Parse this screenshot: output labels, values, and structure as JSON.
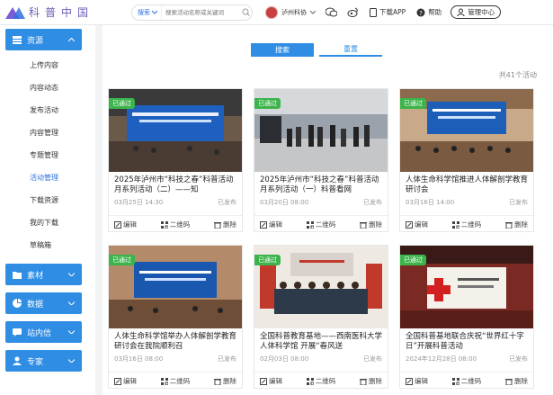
{
  "header": {
    "logo_text": "科普中国",
    "search": {
      "scope": "搜索",
      "placeholder": "搜索活动名称或关键词"
    },
    "org_name": "泸州科协",
    "app_label": "下载APP",
    "help_label": "帮助",
    "admin_label": "管理中心"
  },
  "sidebar": {
    "resources_label": "资源",
    "items": [
      "上传内容",
      "内容动态",
      "发布活动",
      "内容管理",
      "专题管理",
      "活动管理",
      "下载资源",
      "我的下载",
      "草稿箱"
    ],
    "active_index": 5,
    "groups": [
      "素材",
      "数据",
      "站内信",
      "专家"
    ]
  },
  "main": {
    "tab_primary": "搜索",
    "tab_secondary": "重置",
    "total": "共41个活动",
    "cards": [
      {
        "status": "已通过",
        "title": "2025年泸州市“科技之春”科普活动月系列活动（二）——知",
        "date": "03月25日 14:30",
        "state": "已发布",
        "edit": "编辑",
        "qr": "二维码",
        "del": "删除"
      },
      {
        "status": "已通过",
        "title": "2025年泸州市“科技之春”科普活动月系列活动（一）科普看网",
        "date": "03月20日 08:00",
        "state": "已发布",
        "edit": "编辑",
        "qr": "二维码",
        "del": "删除"
      },
      {
        "status": "已通过",
        "title": "人体生命科学馆推进人体解剖学教育研讨会",
        "date": "03月16日 14:00",
        "state": "已发布",
        "edit": "编辑",
        "qr": "二维码",
        "del": "删除"
      },
      {
        "status": "已通过",
        "title": "人体生命科学馆举办人体解剖学教育研讨会在我院顺利召",
        "date": "03月16日 08:00",
        "state": "已发布",
        "edit": "编辑",
        "qr": "二维码",
        "del": "删除"
      },
      {
        "status": "已通过",
        "title": "全国科普教育基地——西南医科大学人体科学馆 开展“春风送",
        "date": "02月03日 08:00",
        "state": "已发布",
        "edit": "编辑",
        "qr": "二维码",
        "del": "删除"
      },
      {
        "status": "已通过",
        "title": "全国科普基地联合庆祝“世界红十字日”开展科普活动",
        "date": "2024年12月28日 08:00",
        "state": "已发布",
        "edit": "编辑",
        "qr": "二维码",
        "del": "删除"
      }
    ]
  },
  "colors": {
    "accent": "#2f8de4",
    "status_green": "#3cb44b"
  }
}
